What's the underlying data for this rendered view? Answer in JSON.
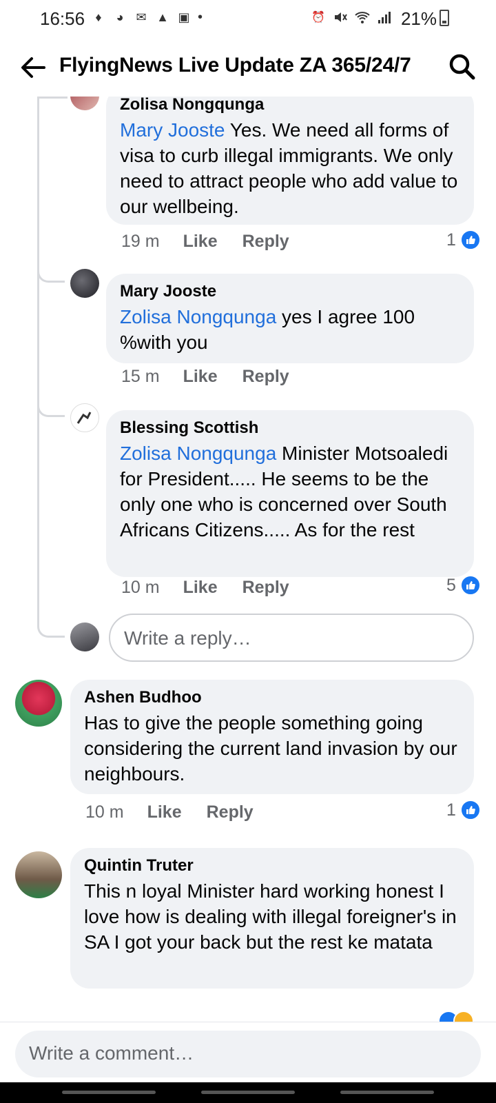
{
  "status_bar": {
    "time": "16:56",
    "battery": "21%"
  },
  "header": {
    "title": "FlyingNews Live Update ZA 365/24/7"
  },
  "comments": [
    {
      "author": "Zolisa Nongqunga",
      "mention": "Mary Jooste",
      "text": " Yes.  We need all forms of visa to curb illegal immigrants. We only need to attract people who add value to our wellbeing.",
      "time": "19 m",
      "like": "Like",
      "reply": "Reply",
      "reactions": "1"
    },
    {
      "author": "Mary Jooste",
      "mention": "Zolisa Nongqunga",
      "text": " yes I agree 100 %with you",
      "time": "15 m",
      "like": "Like",
      "reply": "Reply"
    },
    {
      "author": "Blessing Scottish",
      "mention": "Zolisa Nongqunga",
      "text": " Minister Motsoaledi for President..... He seems to be the only one who is concerned over South Africans Citizens..... As for the rest",
      "time": "10 m",
      "like": "Like",
      "reply": "Reply",
      "reactions": "5"
    },
    {
      "author": "Ashen Budhoo",
      "text": "Has to give the people something going considering the current land invasion by our neighbours.",
      "time": "10 m",
      "like": "Like",
      "reply": "Reply",
      "reactions": "1"
    },
    {
      "author": "Quintin Truter",
      "text": "This n loyal Minister hard working honest I love how is dealing with illegal foreigner's in SA I got your back but the rest ke matata"
    }
  ],
  "reply_placeholder": "Write a reply…",
  "comment_placeholder": "Write a comment…",
  "colors": {
    "mention": "#216fdb",
    "like_badge": "#1877f2",
    "bubble": "#f0f2f5",
    "meta": "#65676b"
  }
}
